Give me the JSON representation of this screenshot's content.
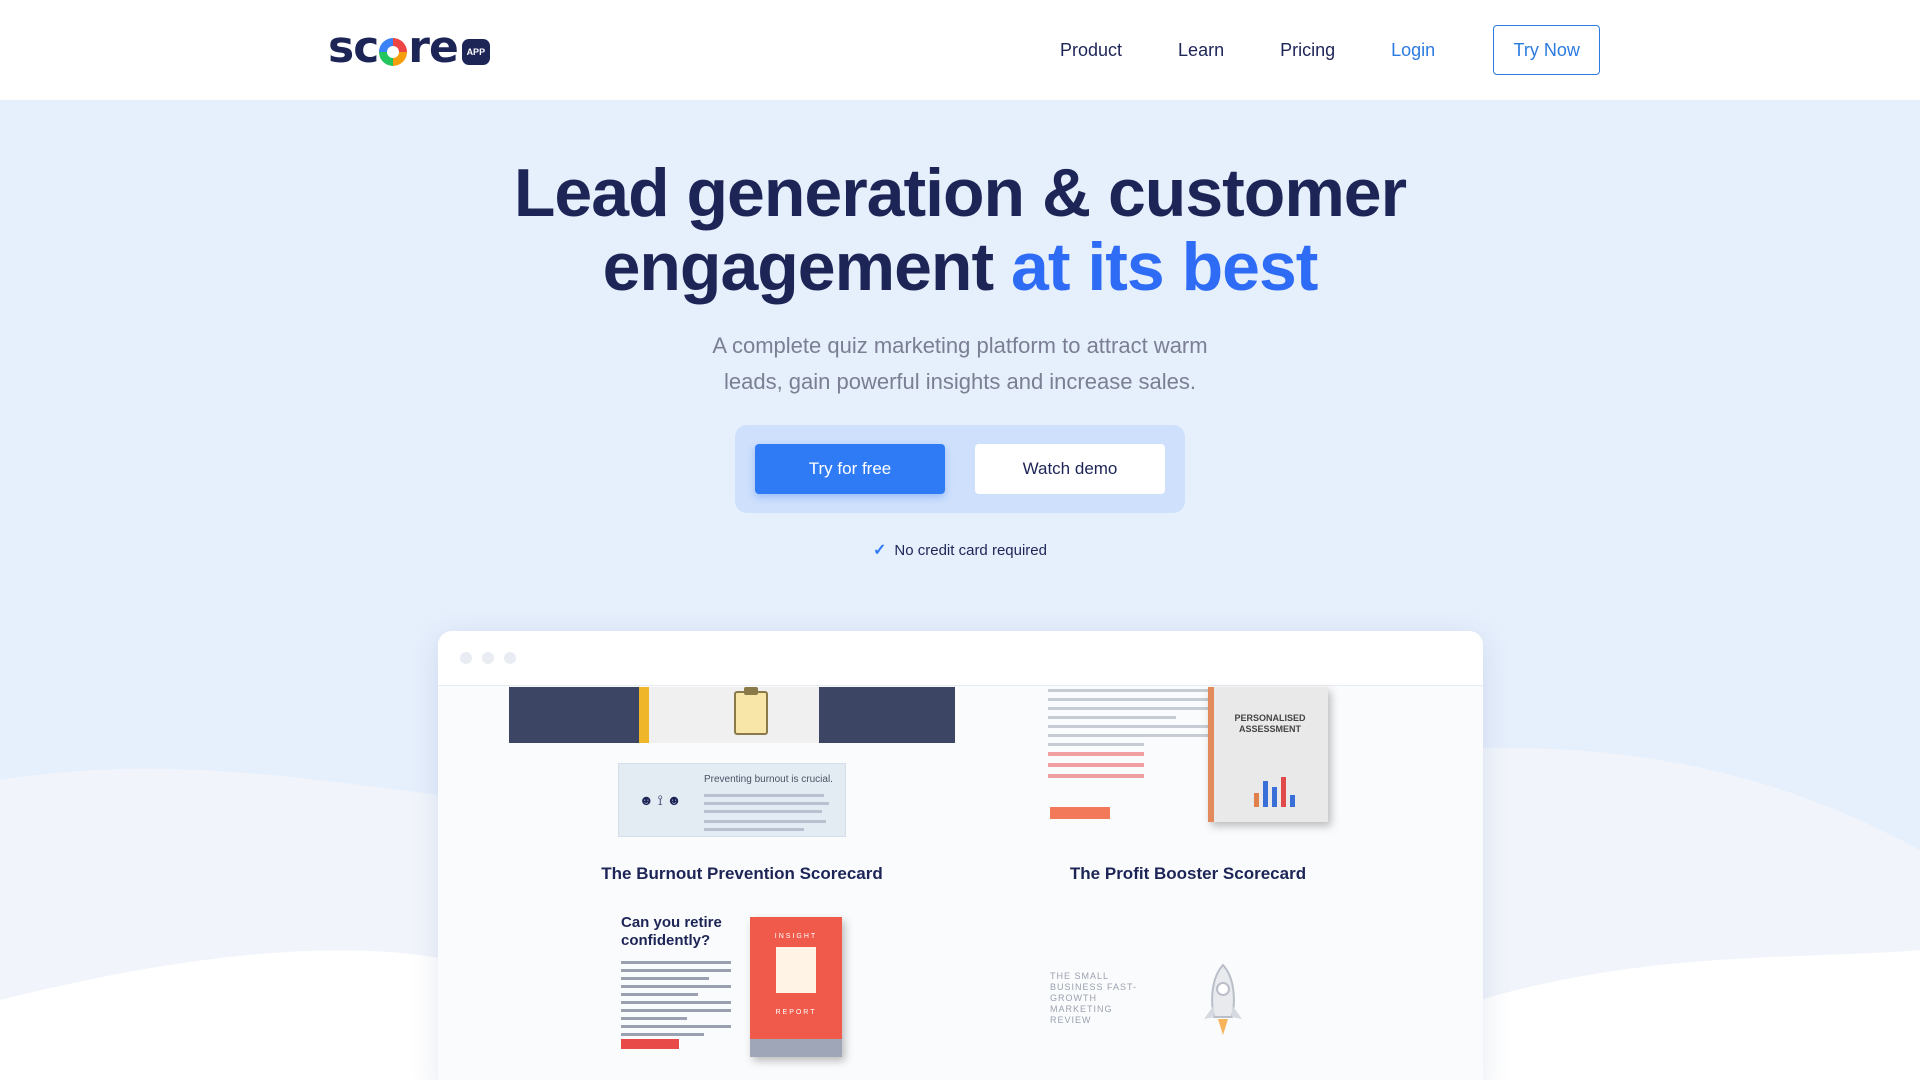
{
  "header": {
    "logo_text_left": "sc",
    "logo_text_right": "re",
    "logo_badge": "APP",
    "nav": [
      "Product",
      "Learn",
      "Pricing"
    ],
    "login": "Login",
    "try_now": "Try Now"
  },
  "hero": {
    "title_line1": "Lead generation & customer",
    "title_line2_plain": "engagement",
    "title_line2_accent": "at its best",
    "subtitle_line1": "A complete quiz marketing platform to attract warm",
    "subtitle_line2": "leads, gain powerful insights and increase sales.",
    "primary_cta": "Try for free",
    "secondary_cta": "Watch demo",
    "note": "No credit card required"
  },
  "preview": {
    "card_a_title": "The Burnout Prevention  Scorecard",
    "card_a_doc_heading": "Preventing burnout is crucial.",
    "card_b_title": "The Profit Booster Scorecard",
    "card_b_book_title": "PERSONALISED ASSESSMENT",
    "card_c_heading": "Can you retire confidently?",
    "card_c_book_label": "INSIGHT",
    "card_c_book_label2": "REPORT",
    "card_d_text": "THE SMALL BUSINESS FAST-GROWTH MARKETING REVIEW"
  },
  "colors": {
    "brand_dark": "#1d2557",
    "accent_blue": "#2f6cf5",
    "link_blue": "#2b7be0",
    "hero_bg": "#e6effc"
  }
}
